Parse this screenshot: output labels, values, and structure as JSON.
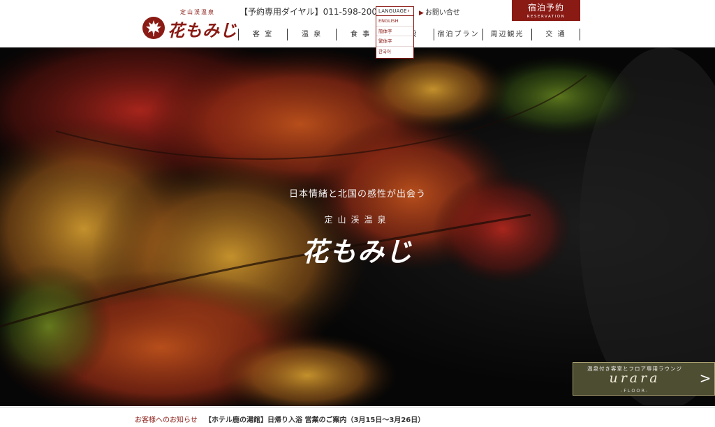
{
  "header": {
    "logo_sub": "定山渓温泉",
    "logo_main": "花もみじ",
    "phone": "【予約専用ダイヤル】011-598-2002",
    "contact_label": "お問い合せ",
    "reserve_main": "宿泊予約",
    "reserve_sub": "RESERVATION"
  },
  "language": {
    "label": "LANGUAGE",
    "options": [
      "ENGLISH",
      "簡体字",
      "繁体字",
      "한국어"
    ]
  },
  "nav": {
    "items": [
      "客 室",
      "温 泉",
      "食 事",
      "施設",
      "宿泊プラン",
      "周辺観光",
      "交 通"
    ]
  },
  "hero": {
    "tagline": "日本情緒と北国の感性が出会う",
    "subtitle": "定山渓温泉",
    "name": "花もみじ"
  },
  "urara": {
    "top": "温泉付き客室とフロア専用ラウンジ",
    "name": "urara",
    "floor": "-FLOOR-"
  },
  "news": {
    "label": "お客様へのお知らせ",
    "text": "【ホテル鹿の湯館】日帰り入浴 営業のご案内（3月15日～3月26日）"
  },
  "colors": {
    "brand": "#8a1a14",
    "hero_bg": "#070707",
    "urara_bg": "#545436"
  }
}
